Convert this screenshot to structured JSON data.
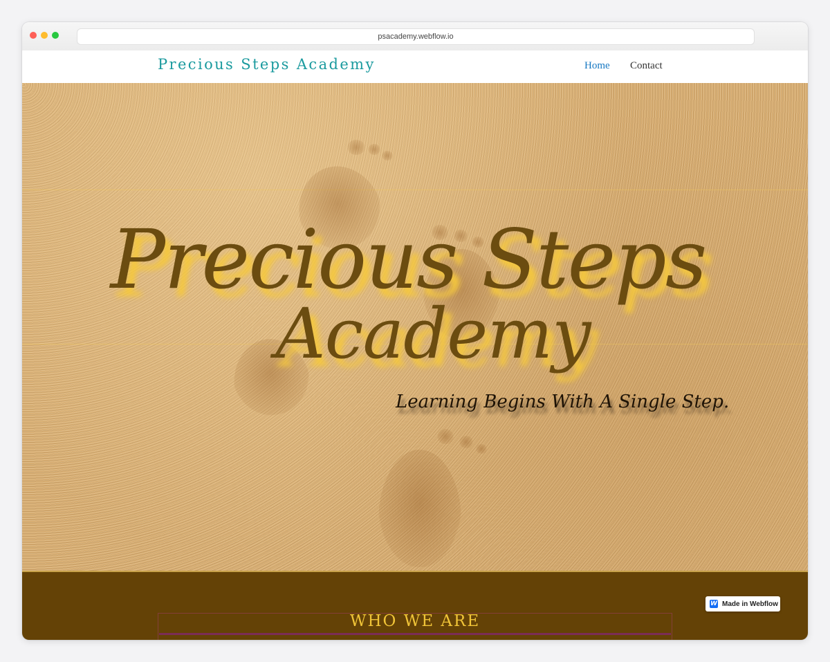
{
  "browser": {
    "url": "psacademy.webflow.io"
  },
  "navbar": {
    "brand": "Precious Steps Academy",
    "links": [
      {
        "label": "Home",
        "active": true
      },
      {
        "label": "Contact",
        "active": false
      }
    ]
  },
  "hero": {
    "title_line1": "Precious Steps",
    "title_line2": "Academy",
    "tagline": "Learning Begins With A Single Step."
  },
  "section": {
    "heading": "WHO WE ARE"
  },
  "badge": {
    "label": "Made in Webflow",
    "icon": "webflow-logo-icon"
  },
  "colors": {
    "brand": "#1a9a9e",
    "nav_active": "#1577c2",
    "title_brown": "#6b4c10",
    "title_shadow": "#f5c83c",
    "section_bg": "#644206",
    "section_heading": "#f0c438"
  }
}
